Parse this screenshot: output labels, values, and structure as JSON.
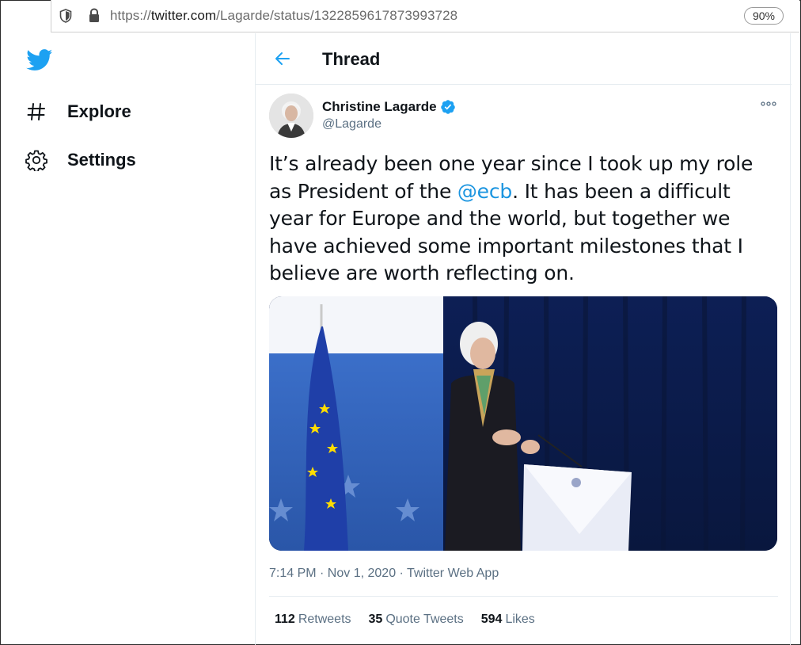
{
  "browser": {
    "url_prefix": "https://",
    "url_host": "twitter.com",
    "url_path": "/Lagarde/status/1322859617873993728",
    "zoom": "90%"
  },
  "sidebar": {
    "items": [
      {
        "label": "Explore",
        "icon": "hash-icon"
      },
      {
        "label": "Settings",
        "icon": "gear-icon"
      }
    ]
  },
  "header": {
    "title": "Thread"
  },
  "tweet": {
    "author_name": "Christine Lagarde",
    "author_handle": "@Lagarde",
    "text_1": "It’s already been one year since I took up my role as President of the ",
    "mention": "@ecb",
    "text_2": ". It has been a difficult year for Europe and the world, but together we have achieved some important milestones that I believe are worth reflecting on.",
    "timestamp": "7:14 PM · Nov 1, 2020 · Twitter Web App",
    "stats": {
      "retweets_count": "112",
      "retweets_label": "Retweets",
      "quotes_count": "35",
      "quotes_label": "Quote Tweets",
      "likes_count": "594",
      "likes_label": "Likes"
    }
  },
  "colors": {
    "accent": "#1da1f2",
    "mention": "#1b95e0",
    "secondary_text": "#5b7083"
  }
}
